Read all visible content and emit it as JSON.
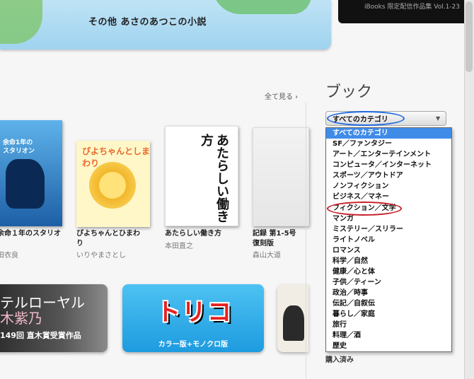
{
  "banner": {
    "left_title": "その他 あさのあつこの小説",
    "right_text": "iBooks 限定配信作品集 Vol.1-23"
  },
  "header": {
    "see_all": "全て見る ›",
    "books_heading": "ブック"
  },
  "books": [
    {
      "cover_text": "余命1年の\nスタリオン",
      "title": "余命１年のスタリオ",
      "author": "田衣良"
    },
    {
      "cover_text": "ぴよちゃんとしまわり",
      "title": "ぴよちゃんとひまわ\nり",
      "author": "いりやまさとし"
    },
    {
      "cover_text": "あたらしい働き方",
      "title": "あたらしい働き方",
      "author": "本田直之"
    },
    {
      "cover_text": "",
      "title": "記録 第1-5号\n復刻版",
      "author": "森山大道"
    }
  ],
  "tiles": [
    {
      "line1": "テルローヤル",
      "line2": "木紫乃",
      "line3": "149回 直木賞受賞作品"
    },
    {
      "logo": "トリコ",
      "sub": "カラー版+モノクロ版"
    },
    {}
  ],
  "category_select": {
    "selected": "すべてのカテゴリ",
    "options": [
      "すべてのカテゴリ",
      "SF／ファンタジー",
      "アート／エンターテインメント",
      "コンピュータ／インターネット",
      "スポーツ／アウトドア",
      "ノンフィクション",
      "ビジネス／マネー",
      "フィクション／文学",
      "マンガ",
      "ミステリー／スリラー",
      "ライトノベル",
      "ロマンス",
      "科学／自然",
      "健康／心と体",
      "子供／ティーン",
      "政治／時事",
      "伝記／自叙伝",
      "暮らし／家庭",
      "旅行",
      "料理／酒",
      "歴史"
    ]
  },
  "purchased_label": "購入済み",
  "colors": {
    "highlight": "#3f8be8",
    "circle_blue": "#1d6ae0",
    "circle_red": "#c8202a"
  }
}
